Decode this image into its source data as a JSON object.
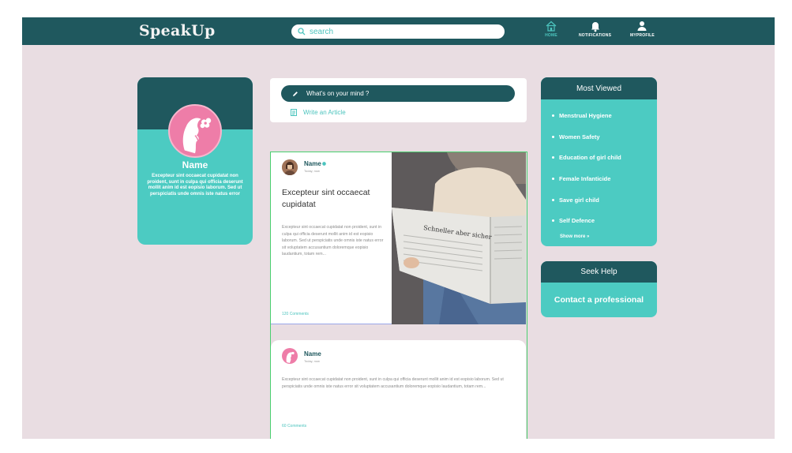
{
  "nav": {
    "logo": "SpeakUp",
    "search_placeholder": "search",
    "items": [
      {
        "label": "HOME",
        "icon": "home-icon",
        "active": true
      },
      {
        "label": "NOTIFICATIONS",
        "icon": "bell-icon"
      },
      {
        "label": "MYPROFILE",
        "icon": "user-icon"
      }
    ]
  },
  "profile": {
    "name": "Name",
    "bio": "Excepteur sint occaecat cupidatat non proident, sunt in culpa qui officia deserunt mollit anim id est eopisio laborum. Sed ut perspiciatis unde omnis iste natus error"
  },
  "composer": {
    "prompt": "What's on your mind ?",
    "article_link": "Write an Article"
  },
  "posts": [
    {
      "author": "Name",
      "time": "Today, now",
      "title": "Excepteur sint occaecat cupidatat",
      "body": "Excepteur sint occaecat cupidatat non proident, sunt in culpa qui officia deserunt mollit anim id est eopisio laborum. Sed ut perspiciatis unde omnis iste natus error sit voluptatem accusantium doloremque eopisio laudantium, totam rem...",
      "comments": "120 Comments"
    },
    {
      "author": "Name",
      "time": "Today, now",
      "body": "Excepteur sint occaecat cupidatat non proident, sunt in culpa qui officia deserunt mollit anim id est eopisio laborum. Sed ut perspiciatis unde omnis iste natus error sit voluptatem accusantium doloremque eopisio laudantium, totam rem...",
      "comments": "60 Comments"
    }
  ],
  "most_viewed": {
    "title": "Most Viewed",
    "items": [
      "Menstrual Hygiene",
      "Women Safety",
      "Education of girl child",
      "Female Infanticide",
      "Save girl child",
      "Self Defence"
    ],
    "more": "Show more »"
  },
  "seek_help": {
    "title": "Seek Help",
    "button": "Contact a professional"
  },
  "colors": {
    "primary": "#1f585e",
    "accent": "#4ccbc2",
    "background": "#e9dde2",
    "pink": "#ee7da8"
  }
}
